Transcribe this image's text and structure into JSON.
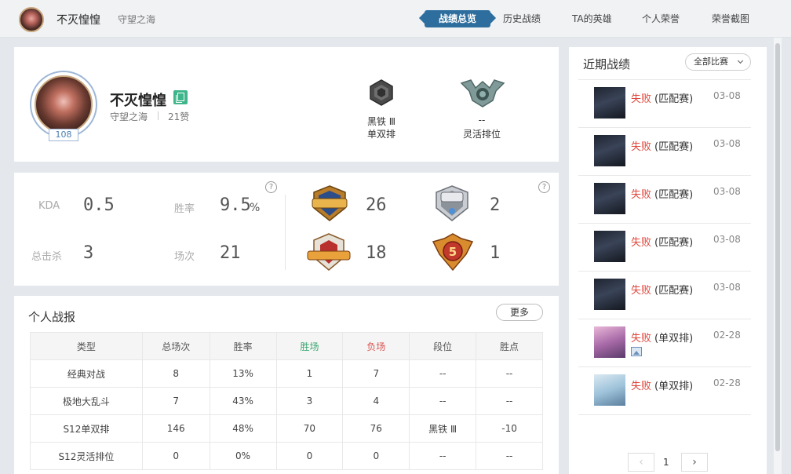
{
  "header": {
    "player_name": "不灭惶惶",
    "server": "守望之海",
    "tabs": [
      {
        "label": "战绩总览",
        "active": true
      },
      {
        "label": "历史战绩",
        "active": false
      },
      {
        "label": "TA的英雄",
        "active": false
      },
      {
        "label": "个人荣誉",
        "active": false
      },
      {
        "label": "荣誉截图",
        "active": false
      }
    ]
  },
  "profile": {
    "name": "不灭惶惶",
    "server": "守望之海",
    "likes": "21赞",
    "level": "108",
    "solo_rank": {
      "tier": "黑铁 Ⅲ",
      "queue": "单双排"
    },
    "flex_rank": {
      "tier": "--",
      "queue": "灵活排位"
    }
  },
  "stats": {
    "kda_label": "KDA",
    "kda_value": "0.5",
    "winrate_label": "胜率",
    "winrate_value": "9.5",
    "winrate_unit": "%",
    "kills_label": "总击杀",
    "kills_value": "3",
    "games_label": "场次",
    "games_value": "21",
    "help": "?",
    "badges": [
      {
        "name": "MVP",
        "count": "26"
      },
      {
        "name": "SVP",
        "count": "2"
      },
      {
        "name": "LEGENDARY",
        "count": "18"
      },
      {
        "name": "五杀",
        "count": "1"
      }
    ]
  },
  "report": {
    "title": "个人战报",
    "more_label": "更多",
    "columns": [
      "类型",
      "总场次",
      "胜率",
      "胜场",
      "负场",
      "段位",
      "胜点"
    ],
    "rows": [
      [
        "经典对战",
        "8",
        "13%",
        "1",
        "7",
        "--",
        "--"
      ],
      [
        "极地大乱斗",
        "7",
        "43%",
        "3",
        "4",
        "--",
        "--"
      ],
      [
        "S12单双排",
        "146",
        "48%",
        "70",
        "76",
        "黑铁 Ⅲ",
        "-10"
      ],
      [
        "S12灵活排位",
        "0",
        "0%",
        "0",
        "0",
        "--",
        "--"
      ]
    ]
  },
  "recent": {
    "title": "近期战绩",
    "filter": "全部比赛",
    "matches": [
      {
        "result": "失败",
        "mode": "(匹配赛)",
        "date": "03-08",
        "hero": "dark"
      },
      {
        "result": "失败",
        "mode": "(匹配赛)",
        "date": "03-08",
        "hero": "dark"
      },
      {
        "result": "失败",
        "mode": "(匹配赛)",
        "date": "03-08",
        "hero": "dark"
      },
      {
        "result": "失败",
        "mode": "(匹配赛)",
        "date": "03-08",
        "hero": "dark"
      },
      {
        "result": "失败",
        "mode": "(匹配赛)",
        "date": "03-08",
        "hero": "dark"
      },
      {
        "result": "失败",
        "mode": "(单双排)",
        "date": "02-28",
        "hero": "pink"
      },
      {
        "result": "失败",
        "mode": "(单双排)",
        "date": "02-28",
        "hero": "light"
      }
    ],
    "page": "1",
    "prev": "‹",
    "next": "›"
  },
  "colors": {
    "accent": "#2d6e9e",
    "win": "#3aa56f",
    "loss": "#d9534f"
  }
}
